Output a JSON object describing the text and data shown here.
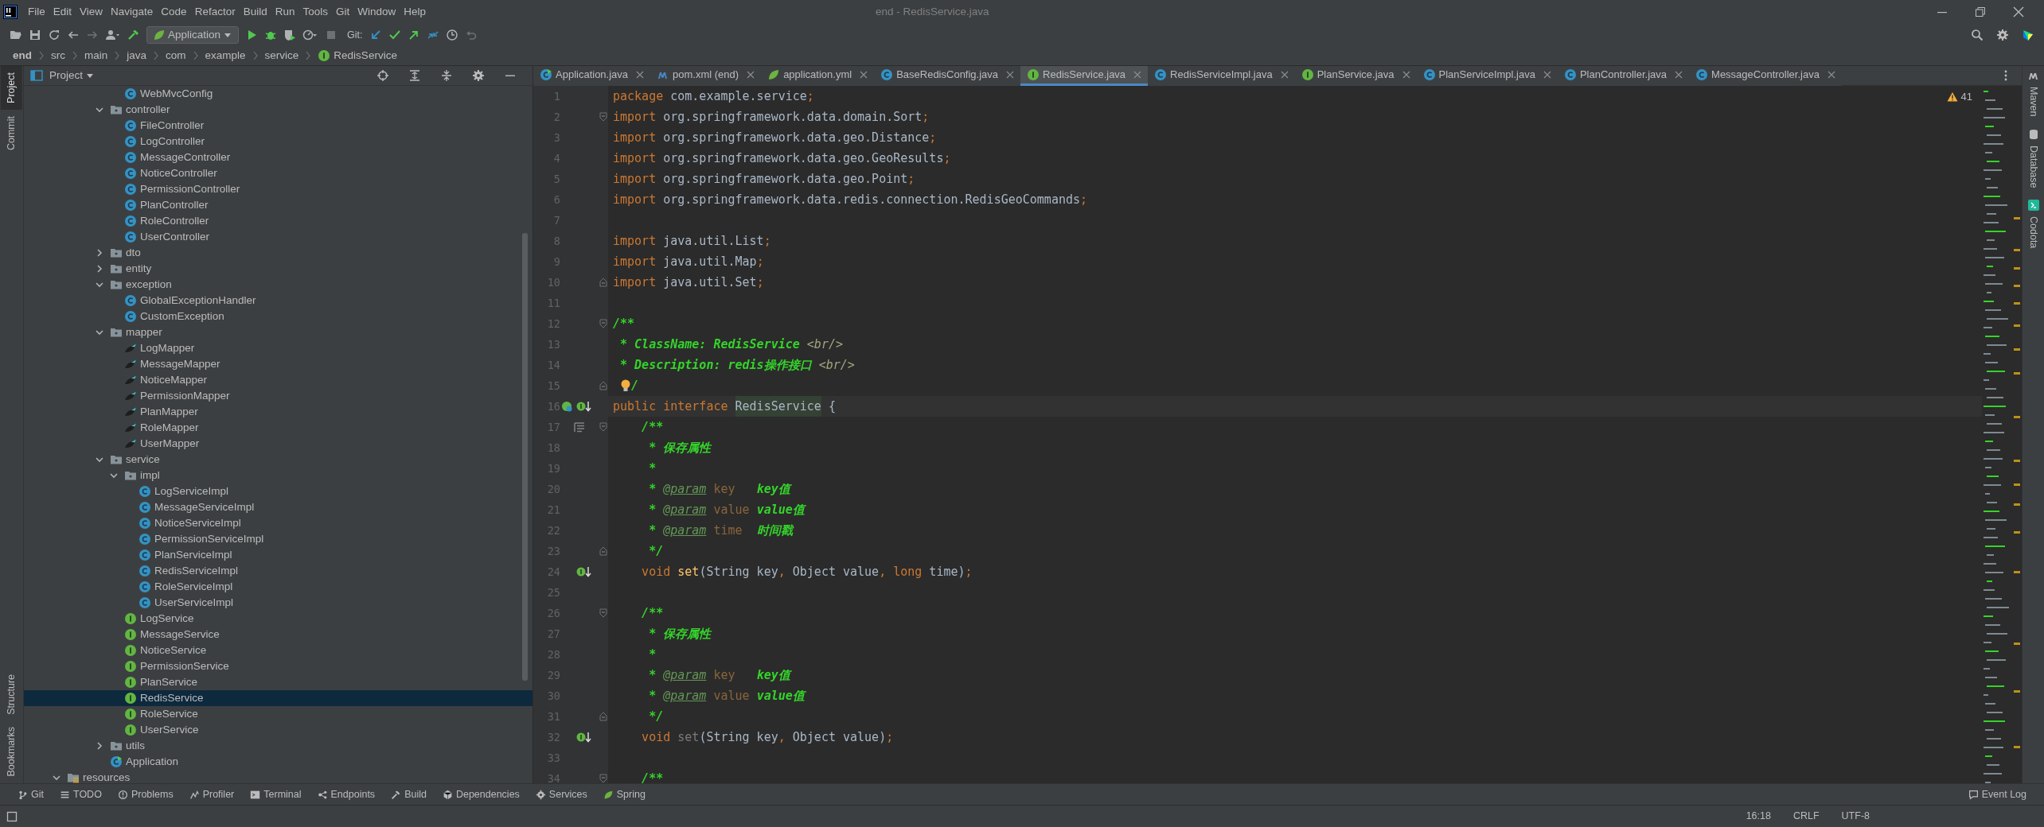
{
  "window": {
    "title": "end - RedisService.java"
  },
  "menu": [
    "File",
    "Edit",
    "View",
    "Navigate",
    "Code",
    "Refactor",
    "Build",
    "Run",
    "Tools",
    "Git",
    "Window",
    "Help"
  ],
  "toolbar": {
    "run_configuration": "Application",
    "git_label": "Git:"
  },
  "breadcrumb": [
    "end",
    "src",
    "main",
    "java",
    "com",
    "example",
    "service",
    "RedisService"
  ],
  "left_stripe": {
    "top": [
      {
        "label": "Project",
        "selected": true
      },
      {
        "label": "Commit",
        "selected": false
      }
    ],
    "bottom": [
      {
        "label": "Structure",
        "selected": false
      },
      {
        "label": "Bookmarks",
        "selected": false
      }
    ]
  },
  "project_panel": {
    "title": "Project",
    "tree": [
      {
        "children": [
          {
            "children": [
              {
                "children": [
                  {
                    "children": [
                      {
                        "label": "WebMvcConfig",
                        "kind": "class",
                        "selected": false
                      }
                    ]
                  },
                  {
                    "label": "controller",
                    "kind": "package",
                    "expanded": true,
                    "selected": false,
                    "children": [
                      {
                        "label": "FileController",
                        "kind": "class",
                        "selected": false
                      },
                      {
                        "label": "LogController",
                        "kind": "class",
                        "selected": false
                      },
                      {
                        "label": "MessageController",
                        "kind": "class",
                        "selected": false
                      },
                      {
                        "label": "NoticeController",
                        "kind": "class",
                        "selected": false
                      },
                      {
                        "label": "PermissionController",
                        "kind": "class",
                        "selected": false
                      },
                      {
                        "label": "PlanController",
                        "kind": "class",
                        "selected": false
                      },
                      {
                        "label": "RoleController",
                        "kind": "class",
                        "selected": false
                      },
                      {
                        "label": "UserController",
                        "kind": "class",
                        "selected": false
                      }
                    ]
                  },
                  {
                    "label": "dto",
                    "kind": "package",
                    "expanded": false,
                    "selected": false
                  },
                  {
                    "label": "entity",
                    "kind": "package",
                    "expanded": false,
                    "selected": false
                  },
                  {
                    "label": "exception",
                    "kind": "package",
                    "expanded": true,
                    "selected": false,
                    "children": [
                      {
                        "label": "GlobalExceptionHandler",
                        "kind": "class",
                        "selected": false
                      },
                      {
                        "label": "CustomException",
                        "kind": "class",
                        "selected": false
                      }
                    ]
                  },
                  {
                    "label": "mapper",
                    "kind": "package",
                    "expanded": true,
                    "selected": false,
                    "children": [
                      {
                        "label": "LogMapper",
                        "kind": "mapper",
                        "selected": false
                      },
                      {
                        "label": "MessageMapper",
                        "kind": "mapper",
                        "selected": false
                      },
                      {
                        "label": "NoticeMapper",
                        "kind": "mapper",
                        "selected": false
                      },
                      {
                        "label": "PermissionMapper",
                        "kind": "mapper",
                        "selected": false
                      },
                      {
                        "label": "PlanMapper",
                        "kind": "mapper",
                        "selected": false
                      },
                      {
                        "label": "RoleMapper",
                        "kind": "mapper",
                        "selected": false
                      },
                      {
                        "label": "UserMapper",
                        "kind": "mapper",
                        "selected": false
                      }
                    ]
                  },
                  {
                    "label": "service",
                    "kind": "package",
                    "expanded": true,
                    "selected": false,
                    "children": [
                      {
                        "label": "impl",
                        "kind": "package",
                        "expanded": true,
                        "selected": false,
                        "children": [
                          {
                            "label": "LogServiceImpl",
                            "kind": "class",
                            "selected": false
                          },
                          {
                            "label": "MessageServiceImpl",
                            "kind": "class",
                            "selected": false
                          },
                          {
                            "label": "NoticeServiceImpl",
                            "kind": "class",
                            "selected": false
                          },
                          {
                            "label": "PermissionServiceImpl",
                            "kind": "class",
                            "selected": false
                          },
                          {
                            "label": "PlanServiceImpl",
                            "kind": "class",
                            "selected": false
                          },
                          {
                            "label": "RedisServiceImpl",
                            "kind": "class",
                            "selected": false
                          },
                          {
                            "label": "RoleServiceImpl",
                            "kind": "class",
                            "selected": false
                          },
                          {
                            "label": "UserServiceImpl",
                            "kind": "class",
                            "selected": false
                          }
                        ]
                      },
                      {
                        "label": "LogService",
                        "kind": "interface",
                        "selected": false
                      },
                      {
                        "label": "MessageService",
                        "kind": "interface",
                        "selected": false
                      },
                      {
                        "label": "NoticeService",
                        "kind": "interface",
                        "selected": false
                      },
                      {
                        "label": "PermissionService",
                        "kind": "interface",
                        "selected": false
                      },
                      {
                        "label": "PlanService",
                        "kind": "interface",
                        "selected": false
                      },
                      {
                        "label": "RedisService",
                        "kind": "interface",
                        "selected": true
                      },
                      {
                        "label": "RoleService",
                        "kind": "interface",
                        "selected": false
                      },
                      {
                        "label": "UserService",
                        "kind": "interface",
                        "selected": false
                      }
                    ]
                  },
                  {
                    "label": "utils",
                    "kind": "package",
                    "expanded": false,
                    "selected": false
                  },
                  {
                    "label": "Application",
                    "kind": "app",
                    "selected": false
                  }
                ]
              }
            ]
          }
        ]
      },
      {
        "label": "resources",
        "kind": "resources",
        "expanded": true,
        "selected": false
      }
    ]
  },
  "tabs": [
    {
      "label": "Application.java",
      "kind": "app",
      "selected": false
    },
    {
      "label": "pom.xml (end)",
      "kind": "maven",
      "selected": false
    },
    {
      "label": "application.yml",
      "kind": "spring",
      "selected": false
    },
    {
      "label": "BaseRedisConfig.java",
      "kind": "class",
      "selected": false
    },
    {
      "label": "RedisService.java",
      "kind": "interface",
      "selected": true
    },
    {
      "label": "RedisServiceImpl.java",
      "kind": "class",
      "selected": false
    },
    {
      "label": "PlanService.java",
      "kind": "interface",
      "selected": false
    },
    {
      "label": "PlanServiceImpl.java",
      "kind": "class",
      "selected": false
    },
    {
      "label": "PlanController.java",
      "kind": "class",
      "selected": false
    },
    {
      "label": "MessageController.java",
      "kind": "class",
      "selected": false
    }
  ],
  "editor": {
    "warnings": "41",
    "lines": [
      {
        "number": "1",
        "tokens": [
          {
            "text": "package",
            "kind": "kw"
          },
          {
            "text": " com.example.service",
            "kind": "plain"
          },
          {
            "text": ";",
            "kind": "kw"
          }
        ]
      },
      {
        "number": "2",
        "fold": {
          "kind": "start"
        },
        "tokens": [
          {
            "text": "import",
            "kind": "kw"
          },
          {
            "text": " org.springframework.data.domain.Sort",
            "kind": "plain"
          },
          {
            "text": ";",
            "kind": "kw"
          }
        ]
      },
      {
        "number": "3",
        "tokens": [
          {
            "text": "import",
            "kind": "kw"
          },
          {
            "text": " org.springframework.data.geo.Distance",
            "kind": "plain"
          },
          {
            "text": ";",
            "kind": "kw"
          }
        ]
      },
      {
        "number": "4",
        "tokens": [
          {
            "text": "import",
            "kind": "kw"
          },
          {
            "text": " org.springframework.data.geo.GeoResults",
            "kind": "plain"
          },
          {
            "text": ";",
            "kind": "kw"
          }
        ]
      },
      {
        "number": "5",
        "tokens": [
          {
            "text": "import",
            "kind": "kw"
          },
          {
            "text": " org.springframework.data.geo.Point",
            "kind": "plain"
          },
          {
            "text": ";",
            "kind": "kw"
          }
        ]
      },
      {
        "number": "6",
        "tokens": [
          {
            "text": "import",
            "kind": "kw"
          },
          {
            "text": " org.springframework.data.redis.connection.RedisGeoCommands",
            "kind": "plain"
          },
          {
            "text": ";",
            "kind": "kw"
          }
        ]
      },
      {
        "number": "7"
      },
      {
        "number": "8",
        "tokens": [
          {
            "text": "import",
            "kind": "kw"
          },
          {
            "text": " java.util.List",
            "kind": "plain"
          },
          {
            "text": ";",
            "kind": "kw"
          }
        ]
      },
      {
        "number": "9",
        "tokens": [
          {
            "text": "import",
            "kind": "kw"
          },
          {
            "text": " java.util.Map",
            "kind": "plain"
          },
          {
            "text": ";",
            "kind": "kw"
          }
        ]
      },
      {
        "number": "10",
        "fold": {
          "kind": "end"
        },
        "tokens": [
          {
            "text": "import",
            "kind": "kw"
          },
          {
            "text": " java.util.Set",
            "kind": "plain"
          },
          {
            "text": ";",
            "kind": "kw"
          }
        ]
      },
      {
        "number": "11"
      },
      {
        "number": "12",
        "fold": {
          "kind": "start"
        },
        "tokens": [
          {
            "text": "/**",
            "kind": "doc"
          }
        ]
      },
      {
        "number": "13",
        "tokens": [
          {
            "text": " * ClassName: RedisService ",
            "kind": "doc"
          },
          {
            "text": "<br/>",
            "kind": "markup"
          }
        ]
      },
      {
        "number": "14",
        "tokens": [
          {
            "text": " * Description: redis操作接口 ",
            "kind": "doc"
          },
          {
            "text": "<br/>",
            "kind": "markup"
          }
        ]
      },
      {
        "number": "15",
        "fold": {
          "kind": "end"
        },
        "tokens": [
          {
            "kind": "bulb"
          },
          {
            "text": "/",
            "kind": "doc"
          }
        ]
      },
      {
        "number": "16",
        "current": true,
        "gutter": {
          "kind": "overridden"
        },
        "tokens": [
          {
            "text": "public ",
            "kind": "kw"
          },
          {
            "text": "interface ",
            "kind": "kw"
          },
          {
            "text": "RedisService",
            "kind": "highlight"
          },
          {
            "text": " {",
            "kind": "plain"
          }
        ]
      },
      {
        "number": "17",
        "fold": {
          "kind": "start"
        },
        "gutter": {
          "kind": "structure"
        },
        "tokens": [
          {
            "text": "    /**",
            "kind": "doc"
          }
        ]
      },
      {
        "number": "18",
        "tokens": [
          {
            "text": "     * 保存属性",
            "kind": "doc"
          }
        ]
      },
      {
        "number": "19",
        "tokens": [
          {
            "text": "     *",
            "kind": "doc"
          }
        ]
      },
      {
        "number": "20",
        "tokens": [
          {
            "text": "     * ",
            "kind": "doc"
          },
          {
            "text": "@param",
            "kind": "tag"
          },
          {
            "text": " key   ",
            "kind": "param"
          },
          {
            "text": "key值",
            "kind": "doc"
          }
        ]
      },
      {
        "number": "21",
        "tokens": [
          {
            "text": "     * ",
            "kind": "doc"
          },
          {
            "text": "@param",
            "kind": "tag"
          },
          {
            "text": " value ",
            "kind": "param"
          },
          {
            "text": "value值",
            "kind": "doc"
          }
        ]
      },
      {
        "number": "22",
        "tokens": [
          {
            "text": "     * ",
            "kind": "doc"
          },
          {
            "text": "@param",
            "kind": "tag"
          },
          {
            "text": " time  ",
            "kind": "param"
          },
          {
            "text": "时间戳",
            "kind": "doc"
          }
        ]
      },
      {
        "number": "23",
        "fold": {
          "kind": "end"
        },
        "tokens": [
          {
            "text": "     */",
            "kind": "doc"
          }
        ]
      },
      {
        "number": "24",
        "gutter": {
          "kind": "implemented"
        },
        "tokens": [
          {
            "text": "    void ",
            "kind": "kw"
          },
          {
            "text": "set",
            "kind": "method"
          },
          {
            "text": "(String key",
            "kind": "plain"
          },
          {
            "text": ",",
            "kind": "kw"
          },
          {
            "text": " Object value",
            "kind": "plain"
          },
          {
            "text": ", ",
            "kind": "kw"
          },
          {
            "text": "long",
            "kind": "kw"
          },
          {
            "text": " time)",
            "kind": "plain"
          },
          {
            "text": ";",
            "kind": "kw"
          }
        ]
      },
      {
        "number": "25"
      },
      {
        "number": "26",
        "fold": {
          "kind": "start"
        },
        "tokens": [
          {
            "text": "    /**",
            "kind": "doc"
          }
        ]
      },
      {
        "number": "27",
        "tokens": [
          {
            "text": "     * 保存属性",
            "kind": "doc"
          }
        ]
      },
      {
        "number": "28",
        "tokens": [
          {
            "text": "     *",
            "kind": "doc"
          }
        ]
      },
      {
        "number": "29",
        "tokens": [
          {
            "text": "     * ",
            "kind": "doc"
          },
          {
            "text": "@param",
            "kind": "tag"
          },
          {
            "text": " key   ",
            "kind": "param"
          },
          {
            "text": "key值",
            "kind": "doc"
          }
        ]
      },
      {
        "number": "30",
        "tokens": [
          {
            "text": "     * ",
            "kind": "doc"
          },
          {
            "text": "@param",
            "kind": "tag"
          },
          {
            "text": " value ",
            "kind": "param"
          },
          {
            "text": "value值",
            "kind": "doc"
          }
        ]
      },
      {
        "number": "31",
        "fold": {
          "kind": "end"
        },
        "tokens": [
          {
            "text": "     */",
            "kind": "doc"
          }
        ]
      },
      {
        "number": "32",
        "gutter": {
          "kind": "implemented"
        },
        "tokens": [
          {
            "text": "    void ",
            "kind": "kw"
          },
          {
            "text": "set",
            "kind": "unused"
          },
          {
            "text": "(String key",
            "kind": "plain"
          },
          {
            "text": ",",
            "kind": "kw"
          },
          {
            "text": " Object value)",
            "kind": "plain"
          },
          {
            "text": ";",
            "kind": "kw"
          }
        ]
      },
      {
        "number": "33"
      },
      {
        "number": "34",
        "fold": {
          "kind": "start"
        },
        "tokens": [
          {
            "text": "    /**",
            "kind": "doc"
          }
        ]
      }
    ]
  },
  "right_stripe": [
    {
      "label": "Maven",
      "kind": "maven"
    },
    {
      "label": "Database",
      "kind": "database"
    },
    {
      "label": "Codota",
      "kind": "codota"
    }
  ],
  "bottom_tools": [
    {
      "label": "Git",
      "kind": "git"
    },
    {
      "label": "TODO",
      "kind": "todo"
    },
    {
      "label": "Problems",
      "kind": "problems"
    },
    {
      "label": "Profiler",
      "kind": "profiler"
    },
    {
      "label": "Terminal",
      "kind": "terminal"
    },
    {
      "label": "Endpoints",
      "kind": "endpoints"
    },
    {
      "label": "Build",
      "kind": "build"
    },
    {
      "label": "Dependencies",
      "kind": "dependencies"
    },
    {
      "label": "Services",
      "kind": "services"
    },
    {
      "label": "Spring",
      "kind": "spring"
    }
  ],
  "event_log": "Event Log",
  "status_bar": [
    "16:18",
    "CRLF",
    "UTF-8"
  ]
}
